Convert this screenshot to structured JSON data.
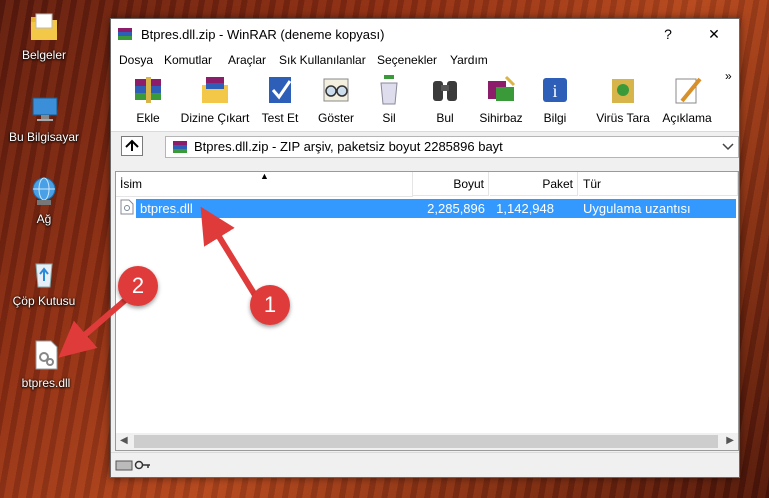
{
  "desktop": {
    "icons": [
      {
        "label": "Belgeler"
      },
      {
        "label": "Bu Bilgisayar"
      },
      {
        "label": "Ağ"
      },
      {
        "label": "Çöp Kutusu"
      },
      {
        "label": "btpres.dll"
      }
    ]
  },
  "window": {
    "title": "Btpres.dll.zip - WinRAR (deneme kopyası)",
    "help_label": "?",
    "close_label": "✕",
    "menu": [
      "Dosya",
      "Komutlar",
      "Araçlar",
      "Sık Kullanılanlar",
      "Seçenekler",
      "Yardım"
    ],
    "toolbar": [
      "Ekle",
      "Dizine Çıkart",
      "Test Et",
      "Göster",
      "Sil",
      "Bul",
      "Sihirbaz",
      "Bilgi",
      "Virüs Tara",
      "Açıklama"
    ],
    "overflow_label": "»",
    "address": "Btpres.dll.zip - ZIP arşiv, paketsiz boyut 2285896 bayt",
    "columns": [
      "İsim",
      "Boyut",
      "Paket",
      "Tür"
    ],
    "files": [
      {
        "name": "btpres.dll",
        "size": "2,285,896",
        "packed": "1,142,948",
        "type": "Uygulama uzantısı"
      }
    ]
  },
  "callouts": [
    "1",
    "2"
  ],
  "colors": {
    "selection": "#3399ff",
    "callout": "#e03b3b"
  }
}
